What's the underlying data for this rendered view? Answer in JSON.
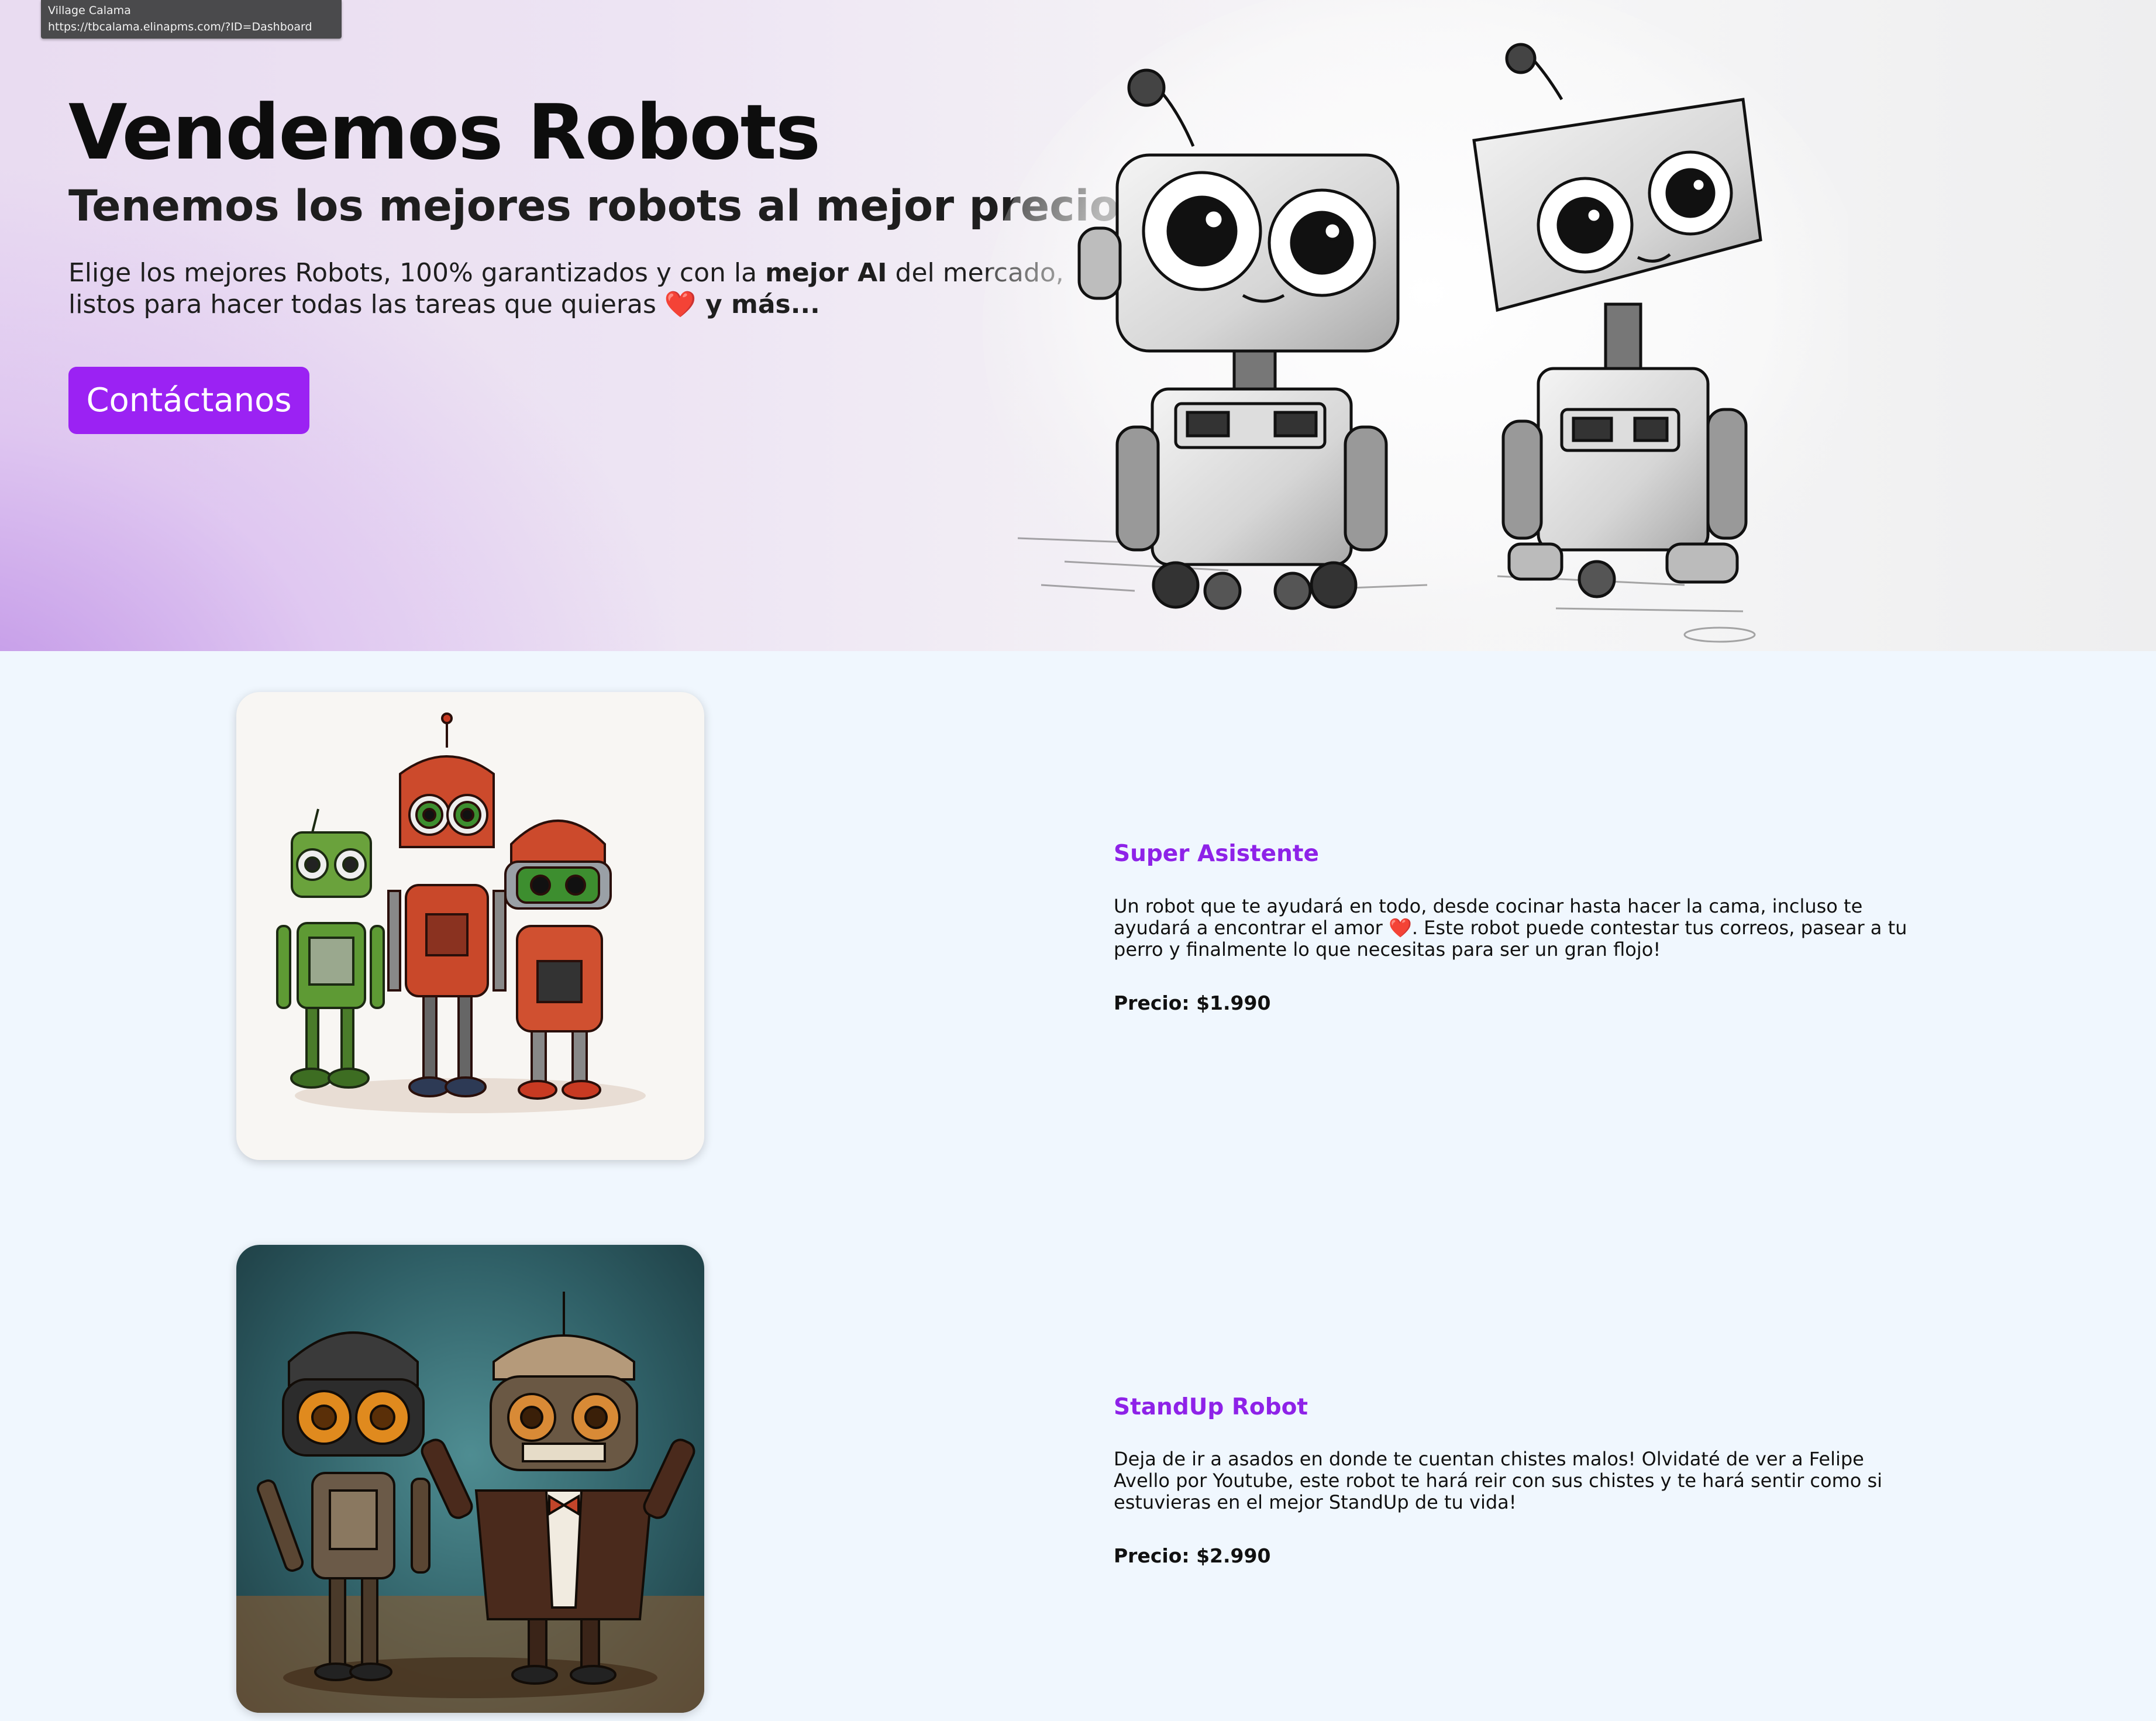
{
  "tooltip": {
    "title": "Village Calama",
    "url": "https://tbcalama.elinapms.com/?ID=Dashboard"
  },
  "hero": {
    "title": "Vendemos Robots",
    "subtitle": "Tenemos los mejores robots al mejor precio",
    "desc_part1": "Elige los mejores Robots, 100% garantizados y con la ",
    "desc_bold1": "mejor AI",
    "desc_part2": " del mercado, listos para hacer todas las tareas que quieras ",
    "desc_heart": "❤️",
    "desc_bold2": " y más...",
    "cta_label": "Contáctanos"
  },
  "products": [
    {
      "name": "Super Asistente",
      "desc_part1": "Un robot que te ayudará en todo, desde cocinar hasta hacer la cama, incluso te ayudará a encontrar el amor ",
      "desc_heart": "❤️",
      "desc_part2": ". Este robot puede contestar tus correos, pasear a tu perro y finalmente lo que necesitas para ser un gran flojo!",
      "price": "Precio: $1.990"
    },
    {
      "name": "StandUp Robot",
      "desc": "Deja de ir a asados en donde te cuentan chistes malos! Olvidaté de ver a Felipe Avello por Youtube, este robot te hará reir con sus chistes y te hará sentir como si estuvieras en el mejor StandUp de tu vida!",
      "price": "Precio: $2.990"
    }
  ],
  "colors": {
    "accent": "#9b22f3",
    "product_title": "#8e22e8",
    "page_background": "#f0f7fe"
  }
}
